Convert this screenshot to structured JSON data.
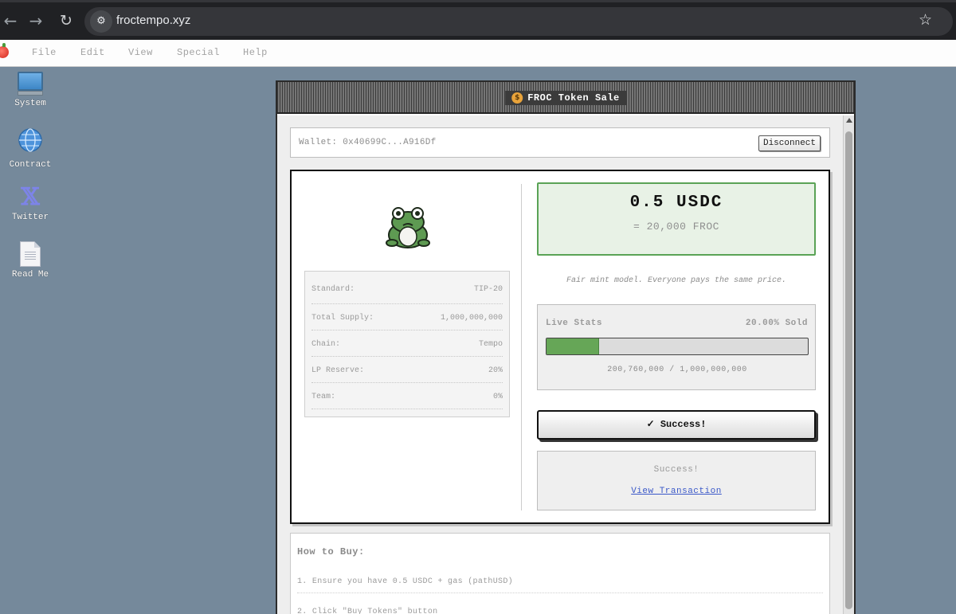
{
  "browser": {
    "url": "froctempo.xyz"
  },
  "menubar": {
    "items": [
      "File",
      "Edit",
      "View",
      "Special",
      "Help"
    ]
  },
  "desktop": {
    "icons": [
      {
        "label": "System",
        "icon": "monitor-icon"
      },
      {
        "label": "Contract",
        "icon": "globe-icon"
      },
      {
        "label": "Twitter",
        "icon": "x-logo-icon"
      },
      {
        "label": "Read Me",
        "icon": "document-icon"
      }
    ]
  },
  "window": {
    "title": "FROC Token Sale",
    "title_icon": "money-bag-icon"
  },
  "wallet": {
    "label": "Wallet: 0x40699C...A916Df",
    "disconnect_label": "Disconnect"
  },
  "token_specs": [
    {
      "key": "Standard:",
      "value": "TIP-20"
    },
    {
      "key": "Total Supply:",
      "value": "1,000,000,000"
    },
    {
      "key": "Chain:",
      "value": "Tempo"
    },
    {
      "key": "LP Reserve:",
      "value": "20%"
    },
    {
      "key": "Team:",
      "value": "0%"
    }
  ],
  "price": {
    "main": "0.5 USDC",
    "sub": "= 20,000 FROC"
  },
  "fair_mint_note": "Fair mint model. Everyone pays the same price.",
  "live_stats": {
    "title": "Live Stats",
    "sold_label": "20.00% Sold",
    "progress_fraction": 0.2,
    "count_label": "200,760,000 / 1,000,000,000"
  },
  "action_button": {
    "label": "✓ Success!"
  },
  "result": {
    "text": "Success!",
    "link_label": "View Transaction"
  },
  "how_to_buy": {
    "title": "How to Buy:",
    "steps": [
      "1. Ensure you have 0.5 USDC + gas (pathUSD)",
      "2. Click \"Buy Tokens\" button"
    ]
  },
  "colors": {
    "desktop_bg": "#75899b",
    "accent_green": "#5aa356",
    "price_bg": "#e8f2e6",
    "link_blue": "#3a58c8"
  }
}
